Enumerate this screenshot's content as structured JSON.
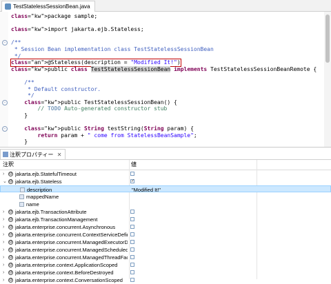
{
  "editor": {
    "tab_title": "TestStatelessSessionBean.java",
    "lines": [
      {
        "t": "package sample;"
      },
      {
        "t": ""
      },
      {
        "t": "import jakarta.ejb.Stateless;"
      },
      {
        "t": ""
      },
      {
        "t": "/**"
      },
      {
        "t": " * Session Bean implementation class TestStatelessSessionBean"
      },
      {
        "t": " */"
      },
      {
        "t": "@Stateless(description = \"Modified It!\")"
      },
      {
        "t": "public class TestStatelessSessionBean implements TestStatelessSessionBeanRemote {"
      },
      {
        "t": ""
      },
      {
        "t": "    /**"
      },
      {
        "t": "     * Default constructor."
      },
      {
        "t": "     */"
      },
      {
        "t": "    public TestStatelessSessionBean() {"
      },
      {
        "t": "        // TODO Auto-generated constructor stub"
      },
      {
        "t": "    }"
      },
      {
        "t": ""
      },
      {
        "t": "    public String testString(String param) {"
      },
      {
        "t": "        return param + \" come from StatelessBeanSample\";"
      },
      {
        "t": "    }"
      }
    ]
  },
  "panel": {
    "tab_title": "注釈プロパティー",
    "close_glyph": "✕",
    "col_annotation": "注釈",
    "col_value": "値",
    "rows": [
      {
        "label": "jakarta.ejb.StatefulTimeout",
        "value": "",
        "checked": false,
        "expand": "›",
        "level": 0
      },
      {
        "label": "jakarta.ejb.Stateless",
        "value": "",
        "checked": true,
        "expand": "⌄",
        "level": 0
      },
      {
        "label": "description",
        "value": "\"Modified It!\"",
        "checked": null,
        "expand": "",
        "level": 1,
        "selected": true
      },
      {
        "label": "mappedName",
        "value": "",
        "checked": null,
        "expand": "",
        "level": 1
      },
      {
        "label": "name",
        "value": "",
        "checked": null,
        "expand": "",
        "level": 1
      },
      {
        "label": "jakarta.ejb.TransactionAttribute",
        "value": "",
        "checked": false,
        "expand": "›",
        "level": 0
      },
      {
        "label": "jakarta.ejb.TransactionManagement",
        "value": "",
        "checked": false,
        "expand": "›",
        "level": 0
      },
      {
        "label": "jakarta.enterprise.concurrent.Asynchronous",
        "value": "",
        "checked": false,
        "expand": "›",
        "level": 0
      },
      {
        "label": "jakarta.enterprise.concurrent.ContextServiceDefinition",
        "value": "",
        "checked": false,
        "expand": "›",
        "level": 0
      },
      {
        "label": "jakarta.enterprise.concurrent.ManagedExecutorDefinit",
        "value": "",
        "checked": false,
        "expand": "›",
        "level": 0
      },
      {
        "label": "jakarta.enterprise.concurrent.ManagedScheduledExecu",
        "value": "",
        "checked": false,
        "expand": "›",
        "level": 0
      },
      {
        "label": "jakarta.enterprise.concurrent.ManagedThreadFactoryD",
        "value": "",
        "checked": false,
        "expand": "›",
        "level": 0
      },
      {
        "label": "jakarta.enterprise.context.ApplicationScoped",
        "value": "",
        "checked": false,
        "expand": "›",
        "level": 0
      },
      {
        "label": "jakarta.enterprise.context.BeforeDestroyed",
        "value": "",
        "checked": false,
        "expand": "›",
        "level": 0
      },
      {
        "label": "jakarta.enterprise.context.ConversationScoped",
        "value": "",
        "checked": false,
        "expand": "›",
        "level": 0
      }
    ]
  }
}
